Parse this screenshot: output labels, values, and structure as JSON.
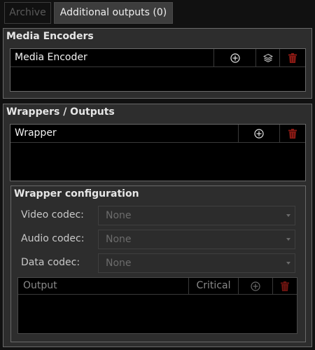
{
  "tabs": {
    "archive": "Archive",
    "additional_outputs": "Additional outputs (0)"
  },
  "media_encoders": {
    "title": "Media Encoders",
    "column_label": "Media Encoder"
  },
  "wrappers": {
    "title": "Wrappers / Outputs",
    "column_label": "Wrapper"
  },
  "wrapper_configuration": {
    "title": "Wrapper configuration",
    "video_codec": {
      "label": "Video codec:",
      "value": "None"
    },
    "audio_codec": {
      "label": "Audio codec:",
      "value": "None"
    },
    "data_codec": {
      "label": "Data codec:",
      "value": "None"
    },
    "outputs_table": {
      "columns": [
        "Output",
        "Critical"
      ]
    }
  },
  "icons": {
    "add": "plus-circle-icon",
    "layers": "layers-icon",
    "delete": "trash-icon"
  },
  "colors": {
    "delete_icon": "#8b1a14",
    "background": "#111111",
    "group_background": "#2d2d2d",
    "panel_background": "#000000"
  }
}
